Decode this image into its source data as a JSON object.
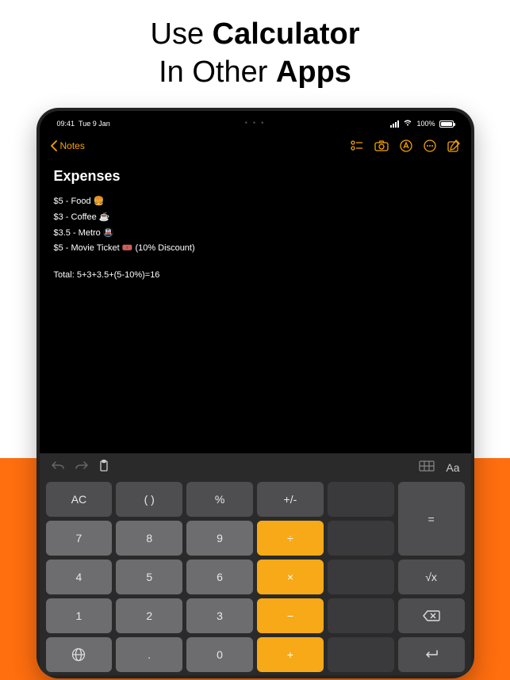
{
  "marketing": {
    "line1a": "Use ",
    "line1b": "Calculator",
    "line2a": "In Other ",
    "line2b": "Apps"
  },
  "status": {
    "time": "09:41",
    "date": "Tue 9 Jan",
    "battery": "100%"
  },
  "nav": {
    "back": "Notes"
  },
  "note": {
    "title": "Expenses",
    "line1": "$5 - Food 🍔",
    "line2": "$3 - Coffee ☕",
    "line3": "$3.5 - Metro 🚇",
    "line4": "$5 - Movie Ticket 🎟️ (10% Discount)",
    "total": "Total: 5+3+3.5+(5-10%)=16"
  },
  "kb_header": {
    "aa": "Aa"
  },
  "keys": {
    "ac": "AC",
    "paren": "( )",
    "percent": "%",
    "plusminus": "+/-",
    "equals": "=",
    "seven": "7",
    "eight": "8",
    "nine": "9",
    "divide": "÷",
    "four": "4",
    "five": "5",
    "six": "6",
    "multiply": "×",
    "sqrt": "√x",
    "one": "1",
    "two": "2",
    "three": "3",
    "minus": "−",
    "dot": ".",
    "zero": "0",
    "plus": "+"
  }
}
